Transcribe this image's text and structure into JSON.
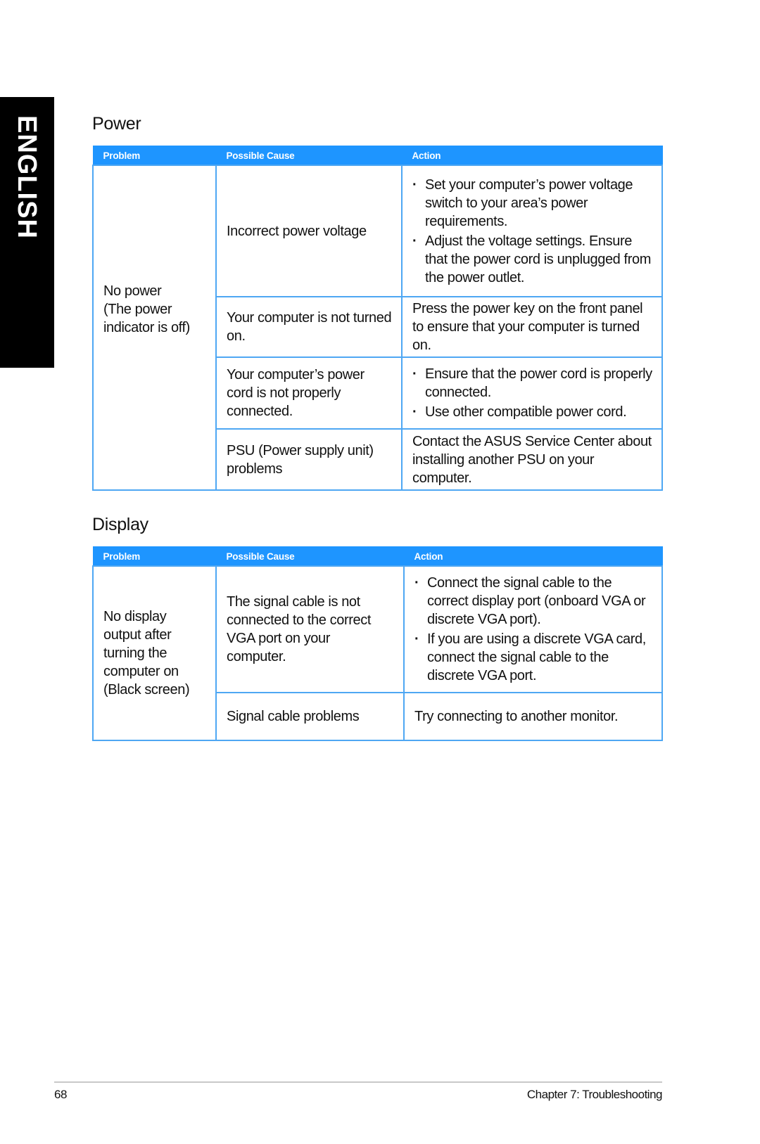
{
  "side_tab": {
    "label": "ENGLISH"
  },
  "power": {
    "title": "Power",
    "headers": [
      "Problem",
      "Possible Cause",
      "Action"
    ],
    "problem": "No power\n(The power\nindicator is off)",
    "rows": [
      {
        "cause": "Incorrect power voltage",
        "action_bullets": [
          "Set your computer’s power voltage switch to your area’s power requirements.",
          "Adjust the voltage settings. Ensure that the power cord is unplugged from the power outlet."
        ]
      },
      {
        "cause": "Your computer is not turned on.",
        "action": "Press the power key on the front panel to ensure that your computer is turned on."
      },
      {
        "cause": "Your computer’s power cord is not properly connected.",
        "action_bullets": [
          "Ensure that the power cord is properly connected.",
          "Use other compatible power cord."
        ]
      },
      {
        "cause": "PSU (Power supply unit) problems",
        "action": "Contact the ASUS Service Center about installing another PSU on your computer."
      }
    ]
  },
  "display": {
    "title": "Display",
    "headers": [
      "Problem",
      "Possible Cause",
      "Action"
    ],
    "problem": "No display output after turning the computer on (Black screen)",
    "rows": [
      {
        "cause": "The signal cable is not connected to the correct VGA port on your computer.",
        "action_bullets": [
          "Connect the signal cable to the correct display port (onboard VGA or discrete VGA port).",
          "If you are using a discrete VGA card, connect the signal cable to the discrete VGA port."
        ]
      },
      {
        "cause": "Signal cable problems",
        "action": "Try connecting to another monitor."
      }
    ]
  },
  "footer": {
    "page_number": "68",
    "chapter": "Chapter 7: Troubleshooting"
  },
  "colors": {
    "header_blue": "#1e95ff",
    "border_blue": "#4ea7f3",
    "tab_black": "#000000"
  }
}
